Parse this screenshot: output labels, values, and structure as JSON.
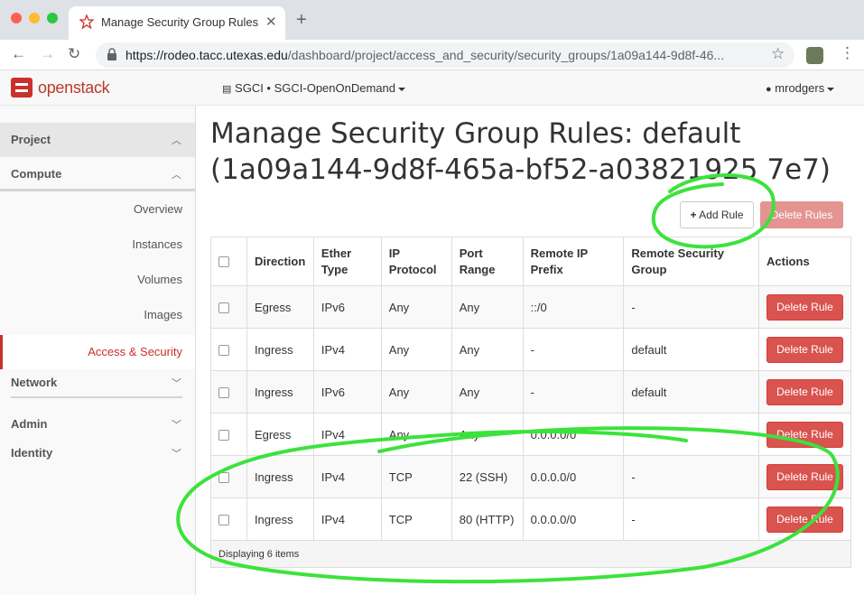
{
  "browser": {
    "tab_title": "Manage Security Group Rules - ",
    "url_host": "https://rodeo.tacc.utexas.edu",
    "url_path": "/dashboard/project/access_and_security/security_groups/1a09a144-9d8f-46..."
  },
  "header": {
    "logo_text": "openstack",
    "project": "SGCI • SGCI-OpenOnDemand",
    "user": "mrodgers"
  },
  "sidebar": {
    "project": "Project",
    "compute": "Compute",
    "items": [
      "Overview",
      "Instances",
      "Volumes",
      "Images",
      "Access & Security"
    ],
    "network": "Network",
    "admin": "Admin",
    "identity": "Identity"
  },
  "main": {
    "title": "Manage Security Group Rules: default (1a09a144-9d8f-465a-bf52-a03821925 7e7)",
    "add_rule": "Add Rule",
    "delete_rules": "Delete Rules",
    "columns": [
      "Direction",
      "Ether Type",
      "IP Protocol",
      "Port Range",
      "Remote IP Prefix",
      "Remote Security Group",
      "Actions"
    ],
    "rows": [
      [
        "Egress",
        "IPv6",
        "Any",
        "Any",
        "::/0",
        "-"
      ],
      [
        "Ingress",
        "IPv4",
        "Any",
        "Any",
        "-",
        "default"
      ],
      [
        "Ingress",
        "IPv6",
        "Any",
        "Any",
        "-",
        "default"
      ],
      [
        "Egress",
        "IPv4",
        "Any",
        "Any",
        "0.0.0.0/0",
        "-"
      ],
      [
        "Ingress",
        "IPv4",
        "TCP",
        "22 (SSH)",
        "0.0.0.0/0",
        "-"
      ],
      [
        "Ingress",
        "IPv4",
        "TCP",
        "80 (HTTP)",
        "0.0.0.0/0",
        "-"
      ]
    ],
    "row_action": "Delete Rule",
    "footer": "Displaying 6 items"
  },
  "colors": {
    "annotation": "#3ce23c",
    "danger": "#d9534f",
    "brand": "#c9312c"
  }
}
